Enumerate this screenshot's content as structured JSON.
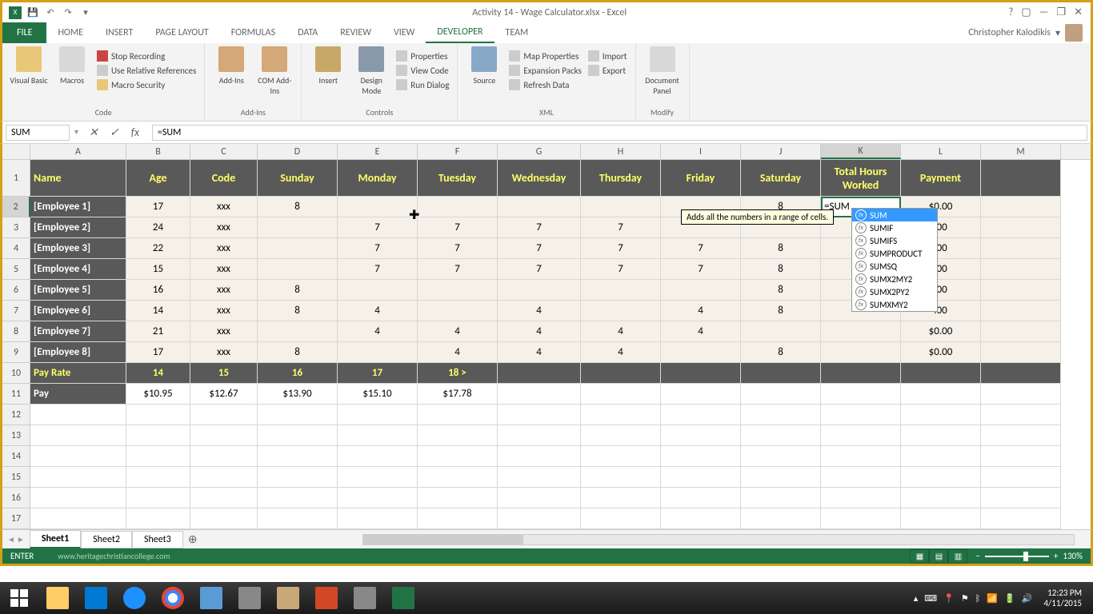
{
  "title": "Activity 14 - Wage Calculator.xlsx - Excel",
  "user": "Christopher Kalodikis",
  "tabs": [
    "HOME",
    "INSERT",
    "PAGE LAYOUT",
    "FORMULAS",
    "DATA",
    "REVIEW",
    "VIEW",
    "DEVELOPER",
    "TEAM"
  ],
  "active_tab": "DEVELOPER",
  "file_tab": "FILE",
  "ribbon_groups": {
    "code": {
      "label": "Code",
      "visual_basic": "Visual Basic",
      "macros": "Macros",
      "record": "Stop Recording",
      "relative": "Use Relative References",
      "security": "Macro Security"
    },
    "addins": {
      "label": "Add-Ins",
      "addins": "Add-Ins",
      "com": "COM Add-Ins"
    },
    "controls": {
      "label": "Controls",
      "insert": "Insert",
      "design": "Design Mode",
      "properties": "Properties",
      "view_code": "View Code",
      "run_dialog": "Run Dialog"
    },
    "xml": {
      "label": "XML",
      "source": "Source",
      "map_props": "Map Properties",
      "expansion": "Expansion Packs",
      "refresh": "Refresh Data",
      "import": "Import",
      "export": "Export"
    },
    "modify": {
      "label": "Modify",
      "doc_panel": "Document Panel"
    }
  },
  "name_box": "SUM",
  "formula": "=SUM",
  "columns": [
    "A",
    "B",
    "C",
    "D",
    "E",
    "F",
    "G",
    "H",
    "I",
    "J",
    "K",
    "L",
    "M"
  ],
  "active_col": "K",
  "active_row": 2,
  "headers": {
    "A": "Name",
    "B": "Age",
    "C": "Code",
    "D": "Sunday",
    "E": "Monday",
    "F": "Tuesday",
    "G": "Wednesday",
    "H": "Thursday",
    "I": "Friday",
    "J": "Saturday",
    "K": "Total Hours Worked",
    "L": "Payment"
  },
  "employees": [
    {
      "name": "[Employee 1]",
      "age": "17",
      "code": "xxx",
      "sun": "8",
      "mon": "",
      "tue": "",
      "wed": "",
      "thu": "",
      "fri": "",
      "sat": "8",
      "total": "=SUM",
      "pay": "$0.00"
    },
    {
      "name": "[Employee 2]",
      "age": "24",
      "code": "xxx",
      "sun": "",
      "mon": "7",
      "tue": "7",
      "wed": "7",
      "thu": "7",
      "fri": "",
      "sat": "",
      "total": "",
      "pay": ".00"
    },
    {
      "name": "[Employee 3]",
      "age": "22",
      "code": "xxx",
      "sun": "",
      "mon": "7",
      "tue": "7",
      "wed": "7",
      "thu": "7",
      "fri": "7",
      "sat": "8",
      "total": "",
      "pay": ".00"
    },
    {
      "name": "[Employee 4]",
      "age": "15",
      "code": "xxx",
      "sun": "",
      "mon": "7",
      "tue": "7",
      "wed": "7",
      "thu": "7",
      "fri": "7",
      "sat": "8",
      "total": "",
      "pay": ".00"
    },
    {
      "name": "[Employee 5]",
      "age": "16",
      "code": "xxx",
      "sun": "8",
      "mon": "",
      "tue": "",
      "wed": "",
      "thu": "",
      "fri": "",
      "sat": "8",
      "total": "",
      "pay": ".00"
    },
    {
      "name": "[Employee 6]",
      "age": "14",
      "code": "xxx",
      "sun": "8",
      "mon": "4",
      "tue": "",
      "wed": "4",
      "thu": "",
      "fri": "4",
      "sat": "8",
      "total": "",
      "pay": ".00"
    },
    {
      "name": "[Employee 7]",
      "age": "21",
      "code": "xxx",
      "sun": "",
      "mon": "4",
      "tue": "4",
      "wed": "4",
      "thu": "4",
      "fri": "4",
      "sat": "",
      "total": "",
      "pay": "$0.00"
    },
    {
      "name": "[Employee 8]",
      "age": "17",
      "code": "xxx",
      "sun": "8",
      "mon": "",
      "tue": "4",
      "wed": "4",
      "thu": "4",
      "fri": "",
      "sat": "8",
      "total": "",
      "pay": "$0.00"
    }
  ],
  "pay_rate_row": {
    "label": "Pay Rate",
    "B": "14",
    "C": "15",
    "D": "16",
    "E": "17",
    "F": "18 >"
  },
  "pay_row": {
    "label": "Pay",
    "B": "$10.95",
    "C": "$12.67",
    "D": "$13.90",
    "E": "$15.10",
    "F": "$17.78"
  },
  "tooltip": "Adds all the numbers in a range of cells.",
  "autocomplete": [
    "SUM",
    "SUMIF",
    "SUMIFS",
    "SUMPRODUCT",
    "SUMSQ",
    "SUMX2MY2",
    "SUMX2PY2",
    "SUMXMY2"
  ],
  "sheets": [
    "Sheet1",
    "Sheet2",
    "Sheet3"
  ],
  "active_sheet": "Sheet1",
  "status_mode": "ENTER",
  "watermark": "www.heritagechristiancollege.com",
  "zoom": "130%",
  "clock": {
    "time": "12:23 PM",
    "date": "4/11/2015"
  }
}
